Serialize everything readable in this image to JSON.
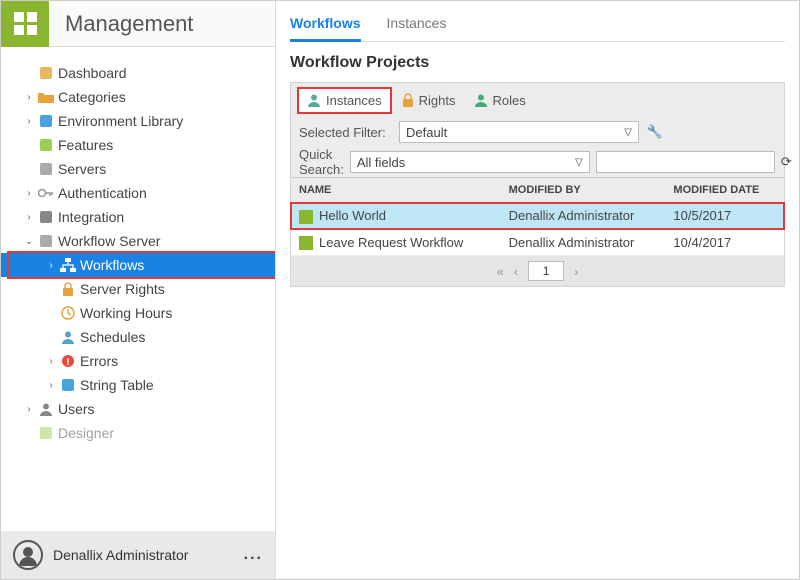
{
  "brand": {
    "title": "Management"
  },
  "sidebar": {
    "items": [
      {
        "label": "Dashboard",
        "dn": "sidebar-dashboard",
        "expandable": false,
        "icon": "dashboard",
        "depth": 0
      },
      {
        "label": "Categories",
        "dn": "sidebar-categories",
        "expandable": true,
        "icon": "folder",
        "depth": 0
      },
      {
        "label": "Environment Library",
        "dn": "sidebar-env-library",
        "expandable": true,
        "icon": "server-blue",
        "depth": 0
      },
      {
        "label": "Features",
        "dn": "sidebar-features",
        "expandable": false,
        "icon": "features",
        "depth": 0
      },
      {
        "label": "Servers",
        "dn": "sidebar-servers",
        "expandable": false,
        "icon": "server-grey",
        "depth": 0
      },
      {
        "label": "Authentication",
        "dn": "sidebar-auth",
        "expandable": true,
        "icon": "key",
        "depth": 0
      },
      {
        "label": "Integration",
        "dn": "sidebar-integration",
        "expandable": true,
        "icon": "puzzle",
        "depth": 0
      },
      {
        "label": "Workflow Server",
        "dn": "sidebar-workflow-server",
        "expandable": true,
        "icon": "server-grey",
        "depth": 0,
        "open": true,
        "underline": true
      },
      {
        "label": "Workflows",
        "dn": "sidebar-workflows",
        "expandable": true,
        "icon": "workflows",
        "depth": 1,
        "selected": true,
        "redbox": true
      },
      {
        "label": "Server Rights",
        "dn": "sidebar-server-rights",
        "expandable": false,
        "icon": "lock",
        "depth": 1
      },
      {
        "label": "Working Hours",
        "dn": "sidebar-working-hours",
        "expandable": false,
        "icon": "clock",
        "depth": 1
      },
      {
        "label": "Schedules",
        "dn": "sidebar-schedules",
        "expandable": false,
        "icon": "people",
        "depth": 1
      },
      {
        "label": "Errors",
        "dn": "sidebar-errors",
        "expandable": true,
        "icon": "error",
        "depth": 1
      },
      {
        "label": "String Table",
        "dn": "sidebar-string-table",
        "expandable": true,
        "icon": "server-blue",
        "depth": 1
      },
      {
        "label": "Users",
        "dn": "sidebar-users",
        "expandable": true,
        "icon": "user",
        "depth": 0
      },
      {
        "label": "Designer",
        "dn": "sidebar-designer",
        "expandable": false,
        "icon": "designer",
        "depth": 0,
        "cutoff": true
      }
    ]
  },
  "user": {
    "name": "Denallix Administrator"
  },
  "mainTabs": [
    {
      "label": "Workflows",
      "active": true
    },
    {
      "label": "Instances",
      "active": false
    }
  ],
  "pageTitle": "Workflow Projects",
  "panelTabs": [
    {
      "label": "Instances",
      "icon": "instances",
      "active": true
    },
    {
      "label": "Rights",
      "icon": "lock",
      "active": false
    },
    {
      "label": "Roles",
      "icon": "roles",
      "active": false
    }
  ],
  "filters": {
    "selectedFilterLabel": "Selected Filter:",
    "selectedFilterValue": "Default",
    "quickSearchLabel": "Quick Search:",
    "quickSearchValue": "All fields"
  },
  "table": {
    "cols": [
      "NAME",
      "MODIFIED BY",
      "MODIFIED DATE"
    ],
    "rows": [
      {
        "name": "Hello World",
        "modBy": "Denallix Administrator",
        "modDate": "10/5/2017",
        "hl": true
      },
      {
        "name": "Leave Request Workflow",
        "modBy": "Denallix Administrator",
        "modDate": "10/4/2017",
        "hl": false
      }
    ]
  },
  "pager": {
    "page": "1"
  }
}
